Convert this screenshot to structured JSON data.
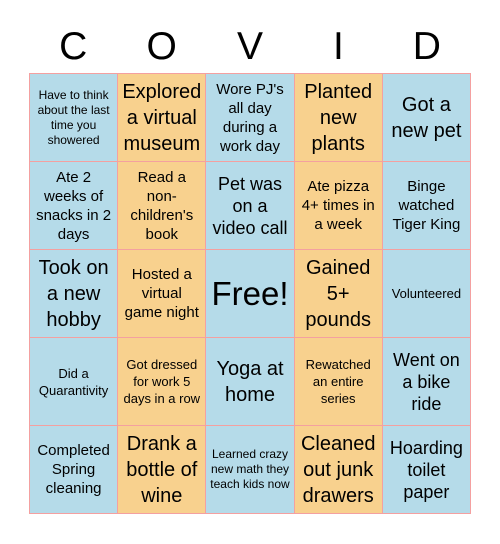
{
  "header": {
    "letters": [
      "C",
      "O",
      "V",
      "I",
      "D"
    ]
  },
  "colors": {
    "blue": "#b5dbe9",
    "orange": "#f8d18e",
    "border": "#f4a0a0"
  },
  "board": {
    "rows": [
      [
        "Have to think about the last time you showered",
        "Explored a virtual museum",
        "Wore PJ's all day during a work day",
        "Planted new plants",
        "Got a new pet"
      ],
      [
        "Ate 2 weeks of snacks in 2 days",
        "Read a non-children's book",
        "Pet was on a video call",
        "Ate pizza 4+ times in a week",
        "Binge watched Tiger King"
      ],
      [
        "Took on a new hobby",
        "Hosted a virtual game night",
        "Free!",
        "Gained 5+ pounds",
        "Volunteered"
      ],
      [
        "Did a Quarantivity",
        "Got dressed for work 5 days in a row",
        "Yoga at home",
        "Rewatched an entire series",
        "Went on a bike ride"
      ],
      [
        "Completed Spring cleaning",
        "Drank a bottle of wine",
        "Learned crazy new math they teach kids now",
        "Cleaned out junk drawers",
        "Hoarding toilet paper"
      ]
    ]
  }
}
